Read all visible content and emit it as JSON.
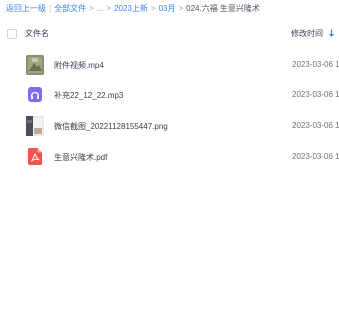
{
  "breadcrumb": {
    "back": "返回上一级",
    "separator": "|",
    "root": "全部文件",
    "ellipsis": "...",
    "folder_1": "2023上新",
    "folder_2": "03月",
    "current": "024.六福 生意兴隆术",
    "arrow": ">"
  },
  "header": {
    "name_label": "文件名",
    "time_label": "修改时间"
  },
  "files": [
    {
      "name": "附件视频.mp4",
      "time": "2023-03-06 1",
      "icon": "video-thumbnail-icon"
    },
    {
      "name": "补充22_12_22.mp3",
      "time": "2023-03-06 1",
      "icon": "audio-file-icon"
    },
    {
      "name": "微信截图_20221128155447.png",
      "time": "2023-03-06 1",
      "icon": "image-thumbnail-icon"
    },
    {
      "name": "生意兴隆术.pdf",
      "time": "2023-03-06 1",
      "icon": "pdf-file-icon"
    }
  ],
  "colors": {
    "link": "#3b82f6",
    "audio_icon": "#7c6cf5",
    "pdf_icon": "#f0524c",
    "sort_arrow": "#3b82f6"
  }
}
